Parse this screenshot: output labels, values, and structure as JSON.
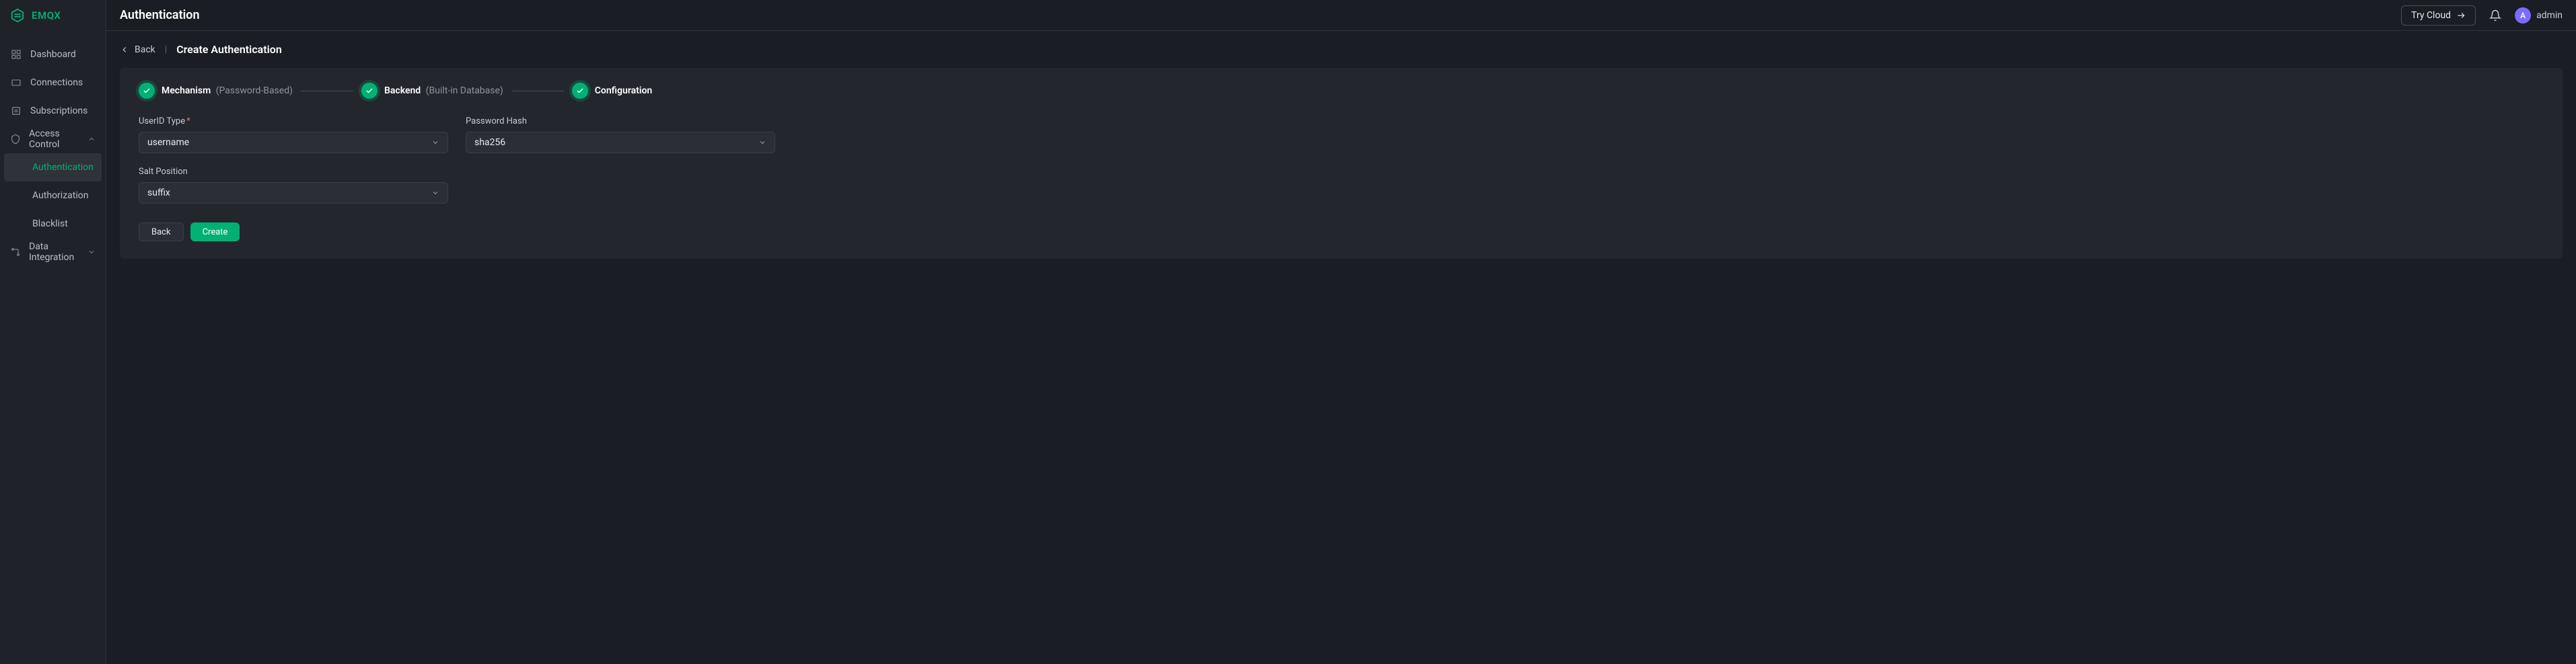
{
  "brand": {
    "name": "EMQX"
  },
  "header": {
    "title": "Authentication",
    "try_cloud": "Try Cloud",
    "user": {
      "name": "admin",
      "initial": "A"
    }
  },
  "sidebar": {
    "items": [
      {
        "label": "Dashboard"
      },
      {
        "label": "Connections"
      },
      {
        "label": "Subscriptions"
      },
      {
        "label": "Access Control",
        "expanded": true
      },
      {
        "label": "Data Integration",
        "expanded": false
      }
    ],
    "access_control_children": [
      {
        "label": "Authentication",
        "active": true
      },
      {
        "label": "Authorization"
      },
      {
        "label": "Blacklist"
      }
    ]
  },
  "crumb": {
    "back": "Back",
    "title": "Create Authentication"
  },
  "stepper": {
    "s1": {
      "label": "Mechanism",
      "sub": "(Password-Based)"
    },
    "s2": {
      "label": "Backend",
      "sub": "(Built-in Database)"
    },
    "s3": {
      "label": "Configuration"
    }
  },
  "form": {
    "userid_type": {
      "label": "UserID Type",
      "value": "username"
    },
    "password_hash": {
      "label": "Password Hash",
      "value": "sha256"
    },
    "salt_position": {
      "label": "Salt Position",
      "value": "suffix"
    }
  },
  "actions": {
    "back": "Back",
    "create": "Create"
  }
}
